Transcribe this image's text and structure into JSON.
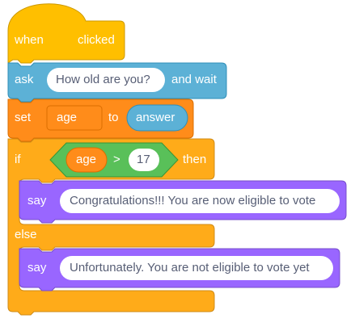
{
  "colors": {
    "events": "#ffbf00",
    "events_border": "#cc9900",
    "sensing": "#5cb1d6",
    "sensing_border": "#2e8eb8",
    "variables": "#ff8c1a",
    "variables_border": "#db6e00",
    "control": "#ffab19",
    "control_border": "#cf8b17",
    "operators": "#59c059",
    "operators_border": "#389438",
    "looks": "#9966ff",
    "looks_border": "#774dcb",
    "input_text": "#575e75"
  },
  "hat_block": {
    "word_when": "when",
    "flag_icon": "green-flag-icon",
    "word_clicked": "clicked"
  },
  "ask_block": {
    "label_ask": "ask",
    "question": "How old are you?",
    "label_and_wait": "and wait"
  },
  "set_block": {
    "label_set": "set",
    "variable": "age",
    "label_to": "to",
    "value_reporter": "answer"
  },
  "if_block": {
    "label_if": "if",
    "condition": {
      "left_reporter": "age",
      "operator": ">",
      "right_value": "17"
    },
    "label_then": "then",
    "label_else": "else"
  },
  "say_then": {
    "label_say": "say",
    "message": "Congratulations!!! You are now eligible to vote"
  },
  "say_else": {
    "label_say": "say",
    "message": "Unfortunately. You are not eligible to vote yet"
  }
}
